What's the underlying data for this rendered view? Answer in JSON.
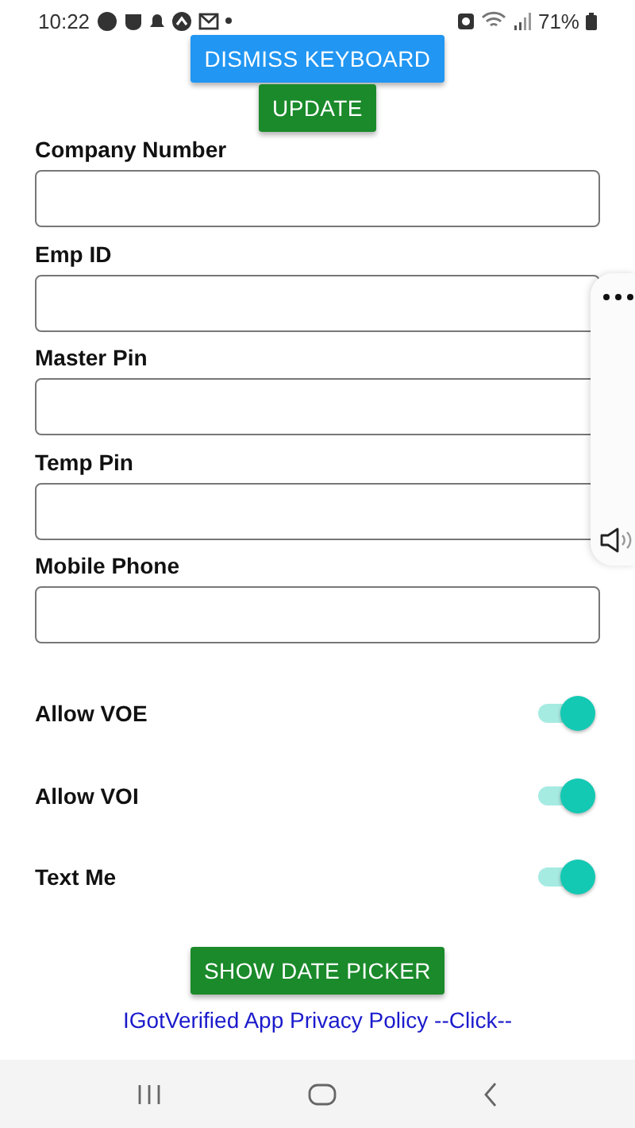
{
  "status_bar": {
    "time": "10:22",
    "battery": "71%"
  },
  "top_buttons": [
    {
      "label": "DISMISS KEYBOARD",
      "kind": "secondary"
    },
    {
      "label": "UPDATE",
      "kind": "primary"
    }
  ],
  "fields": [
    {
      "label": "Company Number"
    },
    {
      "label": "Emp ID"
    },
    {
      "label": "Master Pin"
    },
    {
      "label": "Temp Pin"
    },
    {
      "label": "Mobile Phone"
    }
  ],
  "toggles": [
    {
      "label": "Allow VOE",
      "on": true
    },
    {
      "label": "Allow VOI",
      "on": true
    },
    {
      "label": "Text Me",
      "on": true
    }
  ],
  "date_button": {
    "label": "SHOW DATE PICKER",
    "kind": "primary"
  },
  "privacy_link": "IGotVerified App Privacy Policy --Click--"
}
